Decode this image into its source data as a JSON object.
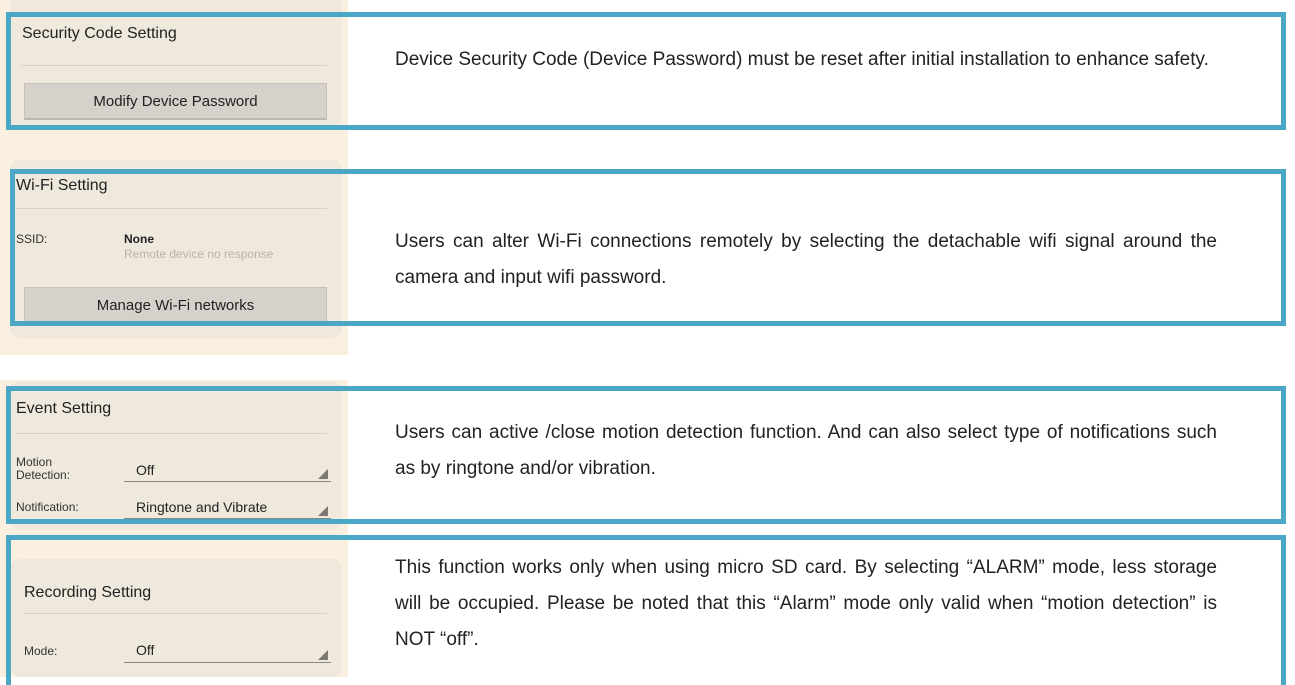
{
  "security": {
    "title": "Security Code Setting",
    "button_label": "Modify Device Password",
    "description": "Device Security Code (Device Password) must be reset after initial installation to enhance safety."
  },
  "wifi": {
    "title": "Wi-Fi Setting",
    "ssid_label": "SSID:",
    "ssid_value": "None",
    "ssid_status": "Remote device no response",
    "button_label": "Manage Wi-Fi networks",
    "description": "Users can alter Wi-Fi connections remotely by selecting the detachable wifi signal around the camera and input wifi password."
  },
  "event": {
    "title": "Event Setting",
    "motion_label": "Motion Detection:",
    "motion_value": "Off",
    "notification_label": "Notification:",
    "notification_value": "Ringtone and Vibrate",
    "description": "Users can active /close motion detection function. And can also select type of notifications such as by ringtone and/or vibration."
  },
  "recording": {
    "title": "Recording Setting",
    "mode_label": "Mode:",
    "mode_value": "Off",
    "description": "This function works only when using micro SD card. By selecting “ALARM” mode, less storage will be occupied. Please be noted that this “Alarm” mode only valid when “motion detection” is NOT “off”."
  },
  "colors": {
    "frame": "#4aa7c6",
    "panel": "#efe8dc",
    "background_strip": "#fbf0df",
    "button": "#d6d1cb"
  }
}
